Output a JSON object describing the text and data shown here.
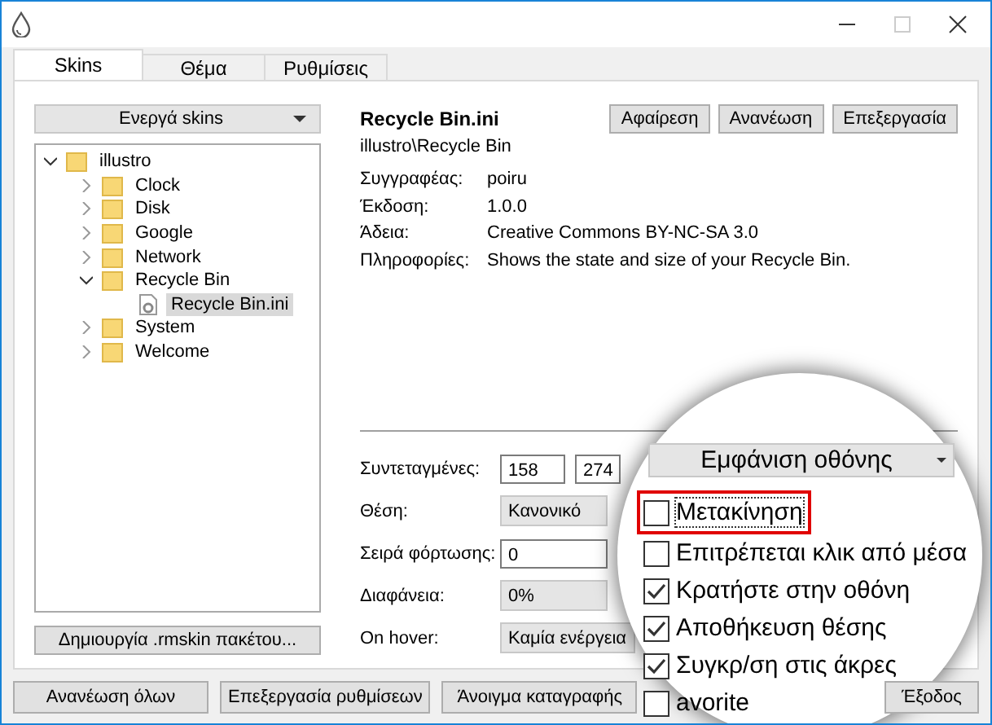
{
  "tabs": [
    {
      "label": "Skins",
      "selected": true
    },
    {
      "label": "Θέμα",
      "selected": false
    },
    {
      "label": "Ρυθμίσεις",
      "selected": false
    }
  ],
  "skins_dropdown": {
    "label": "Ενεργά skins"
  },
  "tree": [
    {
      "label": "illustro",
      "kind": "folder",
      "expanded": true,
      "selected": false,
      "children": [
        {
          "label": "Clock",
          "kind": "folder",
          "expanded": false,
          "selected": false
        },
        {
          "label": "Disk",
          "kind": "folder",
          "expanded": false,
          "selected": false
        },
        {
          "label": "Google",
          "kind": "folder",
          "expanded": false,
          "selected": false
        },
        {
          "label": "Network",
          "kind": "folder",
          "expanded": false,
          "selected": false
        },
        {
          "label": "Recycle Bin",
          "kind": "folder",
          "expanded": true,
          "selected": false,
          "children": [
            {
              "label": "Recycle Bin.ini",
              "kind": "file",
              "selected": true
            }
          ]
        },
        {
          "label": "System",
          "kind": "folder",
          "expanded": false,
          "selected": false
        },
        {
          "label": "Welcome",
          "kind": "folder",
          "expanded": false,
          "selected": false
        }
      ]
    }
  ],
  "create_button": "Δημιουργία .rmskin πακέτου...",
  "details": {
    "title": "Recycle Bin.ini",
    "path": "illustro\\Recycle Bin",
    "buttons": [
      "Αφαίρεση",
      "Ανανέωση",
      "Επεξεργασία"
    ],
    "fields": [
      {
        "label": "Συγγραφέας:",
        "value": "poiru"
      },
      {
        "label": "Έκδοση:",
        "value": "1.0.0"
      },
      {
        "label": "Άδεια:",
        "value": "Creative Commons BY-NC-SA 3.0"
      },
      {
        "label": "Πληροφορίες:",
        "value": "Shows the state and size of your Recycle Bin."
      }
    ]
  },
  "settings": [
    {
      "kind": "coords",
      "label": "Συντεταγμένες:",
      "values": [
        "158",
        "274"
      ]
    },
    {
      "kind": "dropdown",
      "label": "Θέση:",
      "value": "Κανονικό"
    },
    {
      "kind": "input",
      "label": "Σειρά φόρτωσης:",
      "value": "0"
    },
    {
      "kind": "dropdown",
      "label": "Διαφάνεια:",
      "value": "0%"
    },
    {
      "kind": "dropdown",
      "label": "On hover:",
      "value": "Καμία ενέργεια"
    }
  ],
  "magnifier": {
    "dropdown": "Εμφάνιση οθόνης",
    "options": [
      {
        "label": "Μετακίνηση",
        "checked": false,
        "highlighted": true
      },
      {
        "label": "Επιτρέπεται κλικ από μέσα",
        "checked": false,
        "highlighted": false
      },
      {
        "label": "Κρατήστε στην οθόνη",
        "checked": true,
        "highlighted": false
      },
      {
        "label": "Αποθήκευση θέσης",
        "checked": true,
        "highlighted": false
      },
      {
        "label": "Συγκρ/ση στις άκρες",
        "checked": true,
        "highlighted": false
      },
      {
        "label": "avorite",
        "checked": false,
        "highlighted": false
      }
    ]
  },
  "footer_buttons": [
    "Ανανέωση όλων",
    "Επεξεργασία ρυθμίσεων",
    "Άνοιγμα καταγραφής"
  ],
  "exit_button": "Έξοδος"
}
